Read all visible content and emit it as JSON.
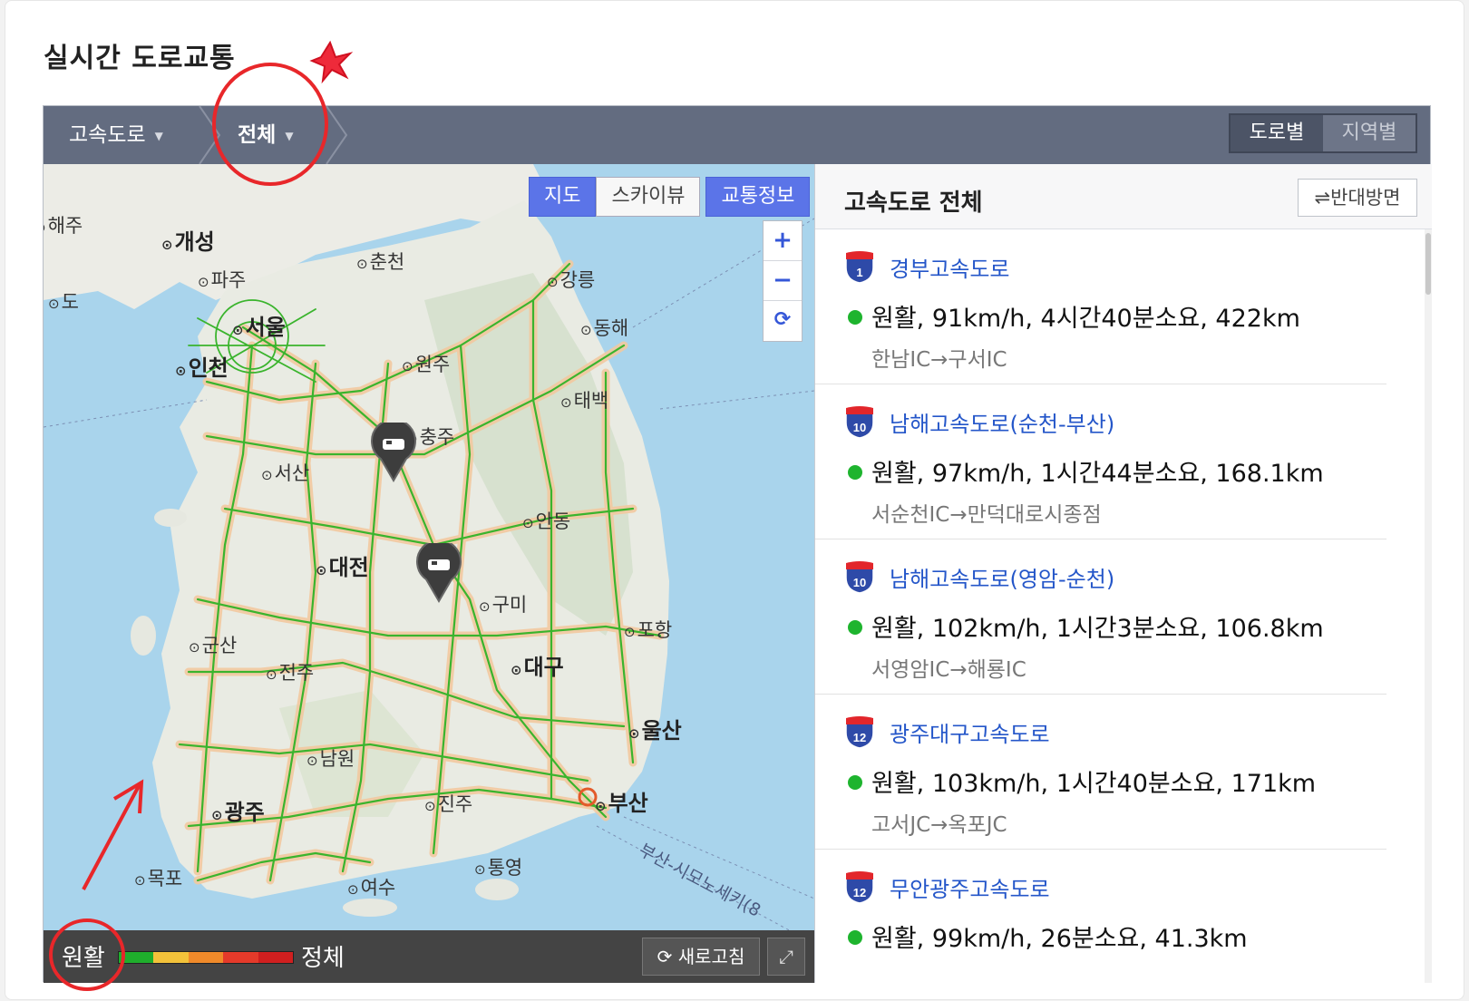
{
  "page_title": "실시간 도로교통",
  "breadcrumb": {
    "level1": "고속도로",
    "level2": "전체"
  },
  "view_toggle": {
    "road": "도로별",
    "region": "지역별"
  },
  "map": {
    "buttons": {
      "map": "지도",
      "skyview": "스카이뷰",
      "traffic": "교통정보"
    },
    "zoom": {
      "in": "+",
      "out": "−",
      "reset": "⟳"
    },
    "cities": {
      "haeju": "해주",
      "gaeseong": "개성",
      "paju": "파주",
      "chuncheon": "춘천",
      "gangneung": "강릉",
      "seoul": "서울",
      "donghae": "동해",
      "incheon": "인천",
      "wonju": "원주",
      "taebaek": "태백",
      "chungju": "충주",
      "seosan": "서산",
      "andong": "안동",
      "daejeon": "대전",
      "gumi": "구미",
      "pohang": "포항",
      "gunsan": "군산",
      "jeonju": "전주",
      "daegu": "대구",
      "ulsan": "울산",
      "namwon": "남원",
      "gwangju": "광주",
      "jinju": "진주",
      "busan": "부산",
      "tongyeong": "통영",
      "mokpo": "목포",
      "yeosu": "여수",
      "ferry": "부산-시모노세키(8",
      "edge_left": "도"
    },
    "legend": {
      "smooth": "원활",
      "congested": "정체",
      "colors": [
        "#1fae2c",
        "#f3c23a",
        "#f08a2a",
        "#e53a2a",
        "#d01f1f"
      ]
    },
    "refresh": "새로고침"
  },
  "panel": {
    "title": "고속도로 전체",
    "reverse_button": "⇌반대방면",
    "roads": [
      {
        "number": "1",
        "name": "경부고속도로",
        "status": "원활, 91km/h, 4시간40분소요, 422km",
        "section": "한남IC→구서IC"
      },
      {
        "number": "10",
        "name": "남해고속도로(순천-부산)",
        "status": "원활, 97km/h, 1시간44분소요, 168.1km",
        "section": "서순천IC→만덕대로시종점"
      },
      {
        "number": "10",
        "name": "남해고속도로(영암-순천)",
        "status": "원활, 102km/h, 1시간3분소요, 106.8km",
        "section": "서영암IC→해룡IC"
      },
      {
        "number": "12",
        "name": "광주대구고속도로",
        "status": "원활, 103km/h, 1시간40분소요, 171km",
        "section": "고서JC→옥포JC"
      },
      {
        "number": "12",
        "name": "무안광주고속도로",
        "status": "원활, 99km/h, 26분소요, 41.3km",
        "section": ""
      }
    ]
  }
}
